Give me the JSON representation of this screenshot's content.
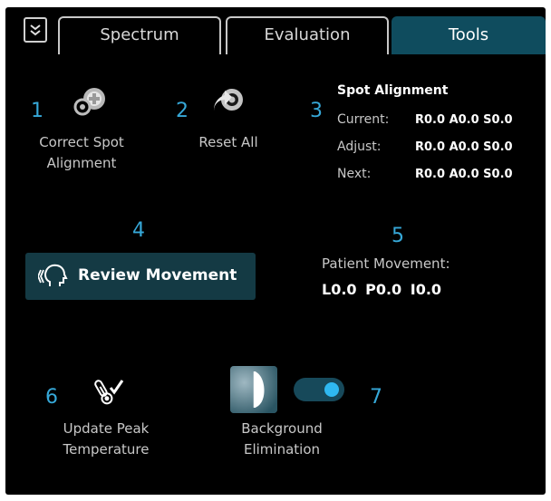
{
  "tabs": {
    "collapse_icon": "double-chevron-down-icon",
    "items": [
      {
        "label": "Spectrum",
        "active": false
      },
      {
        "label": "Evaluation",
        "active": false
      },
      {
        "label": "Tools",
        "active": true
      }
    ]
  },
  "tools": {
    "correct_spot": {
      "number": "1",
      "label_line1": "Correct Spot",
      "label_line2": "Alignment",
      "icon": "spot-target-icon"
    },
    "reset_all": {
      "number": "2",
      "label": "Reset All",
      "icon": "reset-icon"
    },
    "spot_alignment": {
      "number": "3",
      "title": "Spot Alignment",
      "rows": [
        {
          "key": "Current:",
          "value": "R0.0 A0.0 S0.0"
        },
        {
          "key": "Adjust:",
          "value": "R0.0 A0.0 S0.0"
        },
        {
          "key": "Next:",
          "value": "R0.0 A0.0 S0.0"
        }
      ]
    },
    "review_movement": {
      "number": "4",
      "label": "Review Movement",
      "icon": "head-movement-icon"
    },
    "patient_movement": {
      "number": "5",
      "label": "Patient Movement:",
      "values": "L0.0 P0.0 I0.0"
    },
    "update_peak": {
      "number": "6",
      "label_line1": "Update Peak",
      "label_line2": "Temperature",
      "icon": "thermometer-check-icon"
    },
    "background_elimination": {
      "number": "7",
      "label_line1": "Background",
      "label_line2": "Elimination",
      "icon": "background-elimination-icon",
      "toggle_on": true
    }
  },
  "colors": {
    "background": "#000000",
    "active_tab": "#0f4c5e",
    "number_accent": "#36a8d8",
    "button_bg": "#143a44",
    "toggle_knob": "#2fb8f0"
  }
}
